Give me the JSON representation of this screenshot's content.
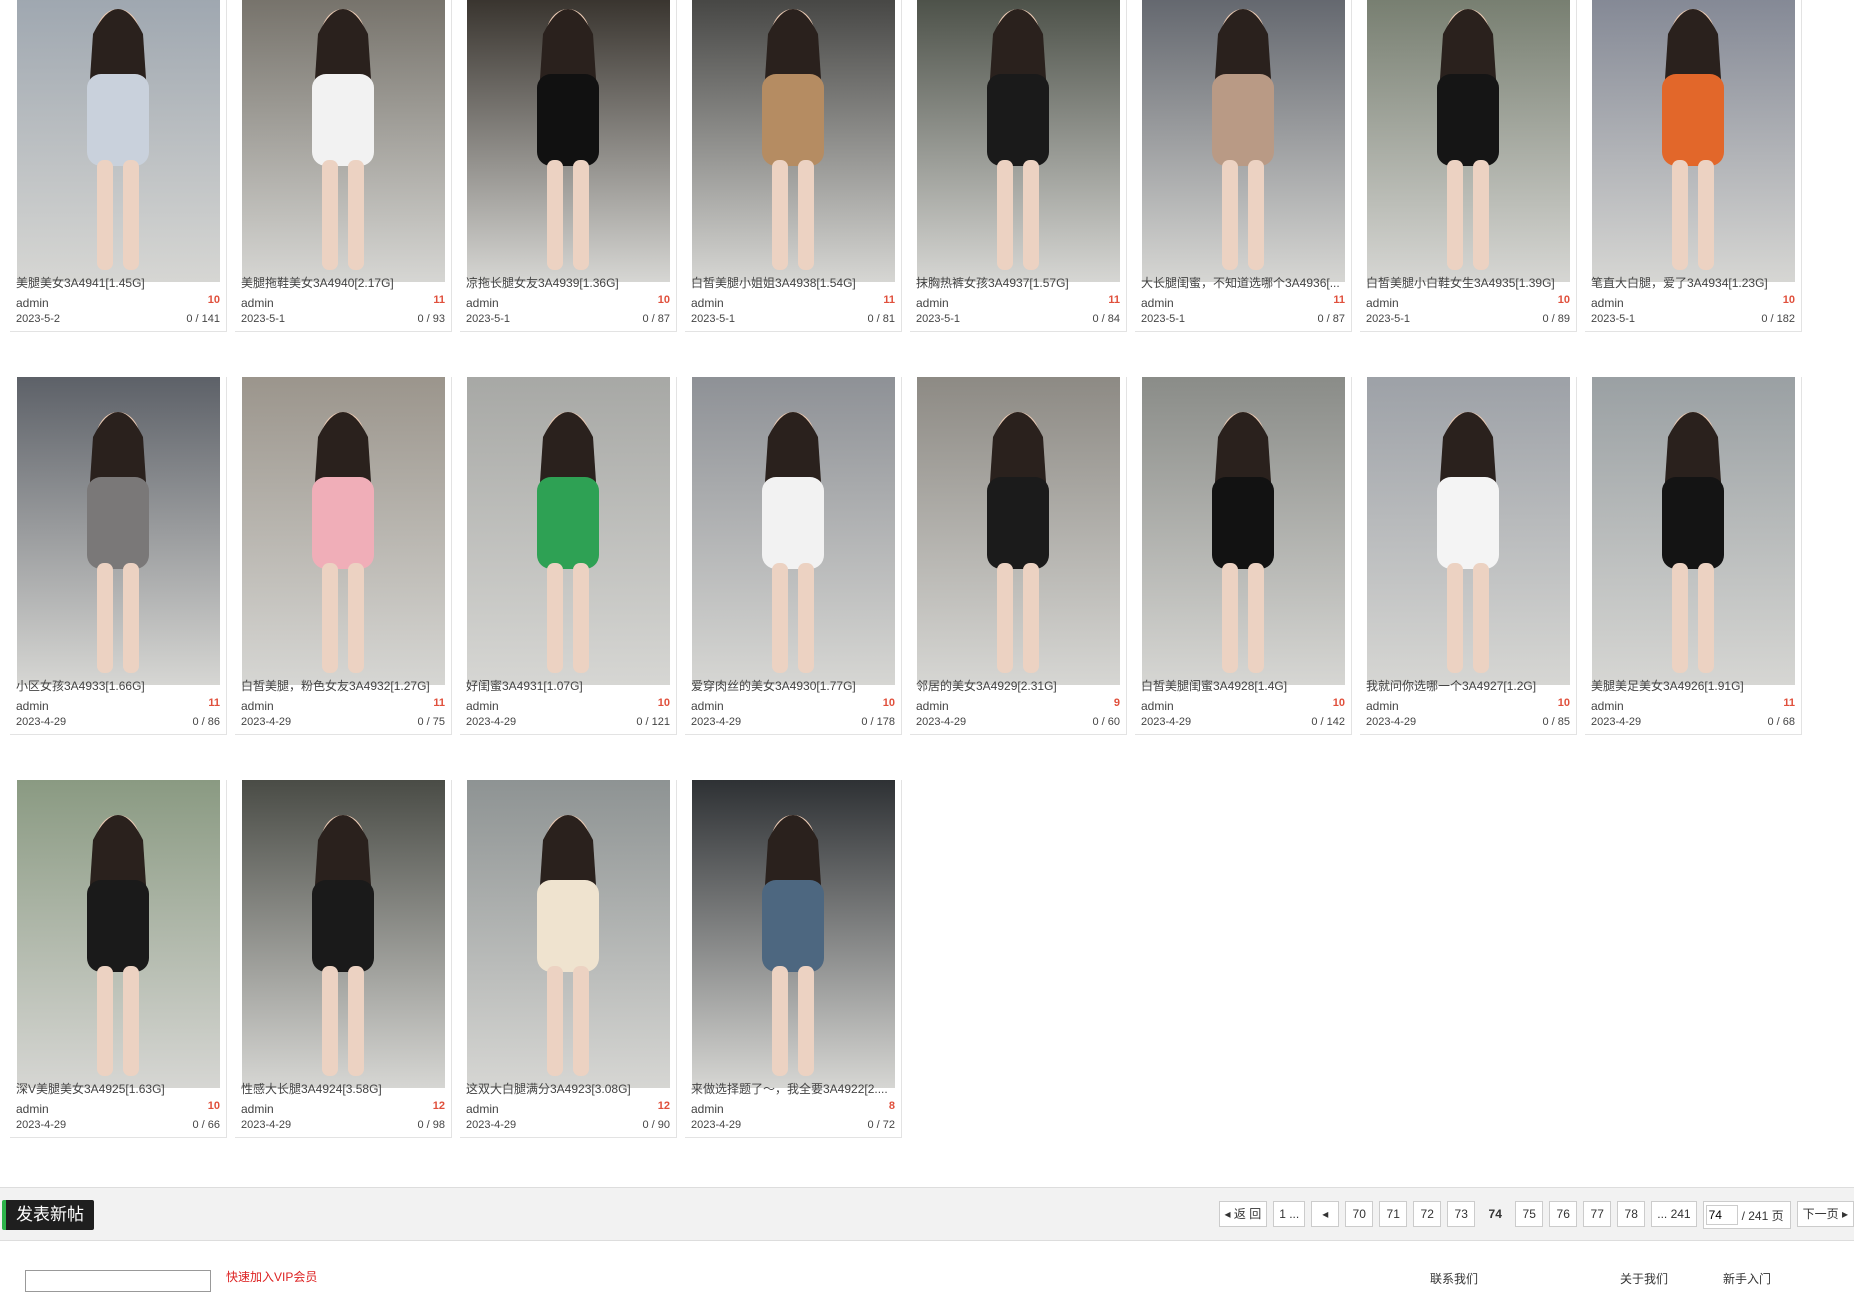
{
  "posts": [
    {
      "title": "美腿美女3A4941[1.45G]",
      "author": "admin",
      "date": "2023-5-2",
      "replies": "10",
      "stats": "0 / 141",
      "bg": "#9aa3ad",
      "accent": "#c9d1dc"
    },
    {
      "title": "美腿拖鞋美女3A4940[2.17G]",
      "author": "admin",
      "date": "2023-5-1",
      "replies": "11",
      "stats": "0 / 93",
      "bg": "#6e6a62",
      "accent": "#f2f2f2"
    },
    {
      "title": "凉拖长腿女友3A4939[1.36G]",
      "author": "admin",
      "date": "2023-5-1",
      "replies": "10",
      "stats": "0 / 87",
      "bg": "#2b2620",
      "accent": "#111111"
    },
    {
      "title": "白皙美腿小姐姐3A4938[1.54G]",
      "author": "admin",
      "date": "2023-5-1",
      "replies": "11",
      "stats": "0 / 81",
      "bg": "#3a3a38",
      "accent": "#b58c62"
    },
    {
      "title": "抹胸热裤女孩3A4937[1.57G]",
      "author": "admin",
      "date": "2023-5-1",
      "replies": "11",
      "stats": "0 / 84",
      "bg": "#41463d",
      "accent": "#1a1a1a"
    },
    {
      "title": "大长腿闺蜜，不知道选哪个3A4936[...",
      "author": "admin",
      "date": "2023-5-1",
      "replies": "11",
      "stats": "0 / 87",
      "bg": "#5a5e66",
      "accent": "#b99a85"
    },
    {
      "title": "白皙美腿小白鞋女生3A4935[1.39G]",
      "author": "admin",
      "date": "2023-5-1",
      "replies": "10",
      "stats": "0 / 89",
      "bg": "#6f7768",
      "accent": "#151515"
    },
    {
      "title": "笔直大白腿，爱了3A4934[1.23G]",
      "author": "admin",
      "date": "2023-5-1",
      "replies": "10",
      "stats": "0 / 182",
      "bg": "#7d8290",
      "accent": "#e2672a"
    },
    {
      "title": "小区女孩3A4933[1.66G]",
      "author": "admin",
      "date": "2023-4-29",
      "replies": "11",
      "stats": "0 / 86",
      "bg": "#5d6168",
      "accent": "#7a7878"
    },
    {
      "title": "白皙美腿，粉色女友3A4932[1.27G]",
      "author": "admin",
      "date": "2023-4-29",
      "replies": "11",
      "stats": "0 / 75",
      "bg": "#9b958c",
      "accent": "#f0aeb8"
    },
    {
      "title": "好闺蜜3A4931[1.07G]",
      "author": "admin",
      "date": "2023-4-29",
      "replies": "10",
      "stats": "0 / 121",
      "bg": "#a7a8a5",
      "accent": "#2ea154"
    },
    {
      "title": "爱穿肉丝的美女3A4930[1.77G]",
      "author": "admin",
      "date": "2023-4-29",
      "replies": "10",
      "stats": "0 / 178",
      "bg": "#8e9196",
      "accent": "#f2f2f2"
    },
    {
      "title": "邻居的美女3A4929[2.31G]",
      "author": "admin",
      "date": "2023-4-29",
      "replies": "9",
      "stats": "0 / 60",
      "bg": "#8d8a84",
      "accent": "#1b1b1b"
    },
    {
      "title": "白皙美腿闺蜜3A4928[1.4G]",
      "author": "admin",
      "date": "2023-4-29",
      "replies": "10",
      "stats": "0 / 142",
      "bg": "#8a8c88",
      "accent": "#121212"
    },
    {
      "title": "我就问你选哪一个3A4927[1.2G]",
      "author": "admin",
      "date": "2023-4-29",
      "replies": "10",
      "stats": "0 / 85",
      "bg": "#9da1a7",
      "accent": "#f4f4f4"
    },
    {
      "title": "美腿美足美女3A4926[1.91G]",
      "author": "admin",
      "date": "2023-4-29",
      "replies": "11",
      "stats": "0 / 68",
      "bg": "#9aa0a3",
      "accent": "#141414"
    },
    {
      "title": "深V美腿美女3A4925[1.63G]",
      "author": "admin",
      "date": "2023-4-29",
      "replies": "10",
      "stats": "0 / 66",
      "bg": "#8a9a82",
      "accent": "#1a1a1a"
    },
    {
      "title": "性感大长腿3A4924[3.58G]",
      "author": "admin",
      "date": "2023-4-29",
      "replies": "12",
      "stats": "0 / 98",
      "bg": "#4a4c46",
      "accent": "#1a1a1a"
    },
    {
      "title": "这双大白腿满分3A4923[3.08G]",
      "author": "admin",
      "date": "2023-4-29",
      "replies": "12",
      "stats": "0 / 90",
      "bg": "#8e9393",
      "accent": "#efe3cf"
    },
    {
      "title": "来做选择题了～，我全要3A4922[2....",
      "author": "admin",
      "date": "2023-4-29",
      "replies": "8",
      "stats": "0 / 72",
      "bg": "#2e3134",
      "accent": "#4d6780"
    }
  ],
  "toolbar": {
    "new_post_label": "发表新帖"
  },
  "pager": {
    "back_label": "返 回",
    "first_label": "1 ...",
    "pages": [
      "70",
      "71",
      "72",
      "73",
      "74",
      "75",
      "76",
      "77",
      "78"
    ],
    "current": "74",
    "last_label": "... 241",
    "jump_value": "74",
    "total_label": "/ 241 页",
    "next_label": "下一页"
  },
  "footer": {
    "red_text": "快速加入VIP会员",
    "link1": "联系我们",
    "link2": "关于我们",
    "link3": "新手入门"
  }
}
